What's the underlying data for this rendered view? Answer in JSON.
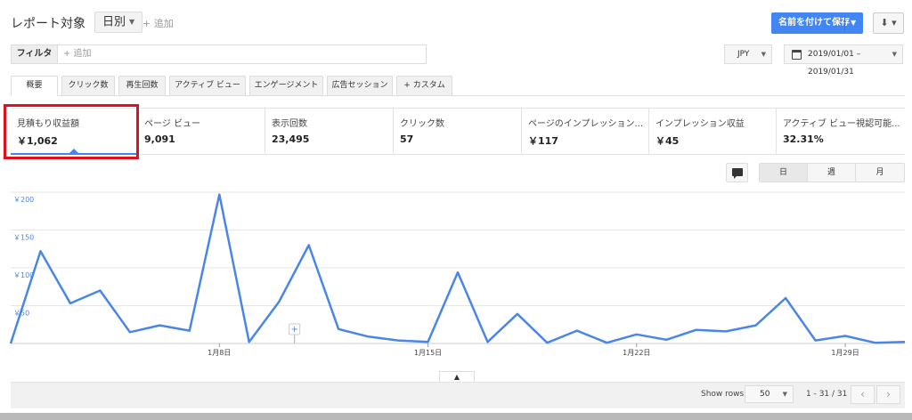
{
  "header": {
    "title": "レポート対象",
    "crumb_separator": "›",
    "dimension_selected": "日別",
    "add_link": "+ 追加",
    "save_button": "名前を付けて保存",
    "download_icon": "download-icon"
  },
  "filter": {
    "label": "フィルタ",
    "placeholder": "+ 追加",
    "currency": "JPY",
    "date_range": "2019/01/01 – 2019/01/31"
  },
  "tabs": [
    {
      "label": "概要",
      "active": true
    },
    {
      "label": "クリック数",
      "active": false
    },
    {
      "label": "再生回数",
      "active": false
    },
    {
      "label": "アクティブ ビュー",
      "active": false
    },
    {
      "label": "エンゲージメント",
      "active": false
    },
    {
      "label": "広告セッション",
      "active": false
    },
    {
      "label": "+ カスタム",
      "active": false
    }
  ],
  "metrics": [
    {
      "label": "見積もり収益額",
      "value": "￥1,062",
      "selected": true
    },
    {
      "label": "ページ ビュー",
      "value": "9,091"
    },
    {
      "label": "表示回数",
      "value": "23,495"
    },
    {
      "label": "クリック数",
      "value": "57"
    },
    {
      "label": "ページのインプレッション...",
      "value": "￥117"
    },
    {
      "label": "インプレッション収益",
      "value": "￥45"
    },
    {
      "label": "アクティブ ビュー視認可能...",
      "value": "32.31%"
    }
  ],
  "granularity": {
    "options": [
      "日",
      "週",
      "月"
    ],
    "selected": "日"
  },
  "chart_data": {
    "type": "line",
    "series": [
      {
        "values": [
          0,
          122,
          53,
          70,
          15,
          24,
          17,
          197,
          2,
          55,
          130,
          19,
          9,
          4,
          2,
          94,
          2,
          39,
          1,
          17,
          1,
          12,
          5,
          18,
          16,
          24,
          60,
          4,
          10,
          1,
          2
        ]
      }
    ],
    "y_ticks": [
      "￥200",
      "￥150",
      "￥100",
      "￥50"
    ],
    "ylim": [
      0,
      200
    ],
    "x_tick_labels": [
      "1月8日",
      "1月15日",
      "1月22日",
      "1月29日"
    ],
    "x_tick_days": [
      8,
      15,
      22,
      29
    ],
    "days": 31,
    "color": "#4a86e8",
    "grid": true
  },
  "footer": {
    "show_rows_label": "Show rows",
    "rows_value": "50",
    "range": "1 - 31 / 31",
    "prev": "‹",
    "next": "›",
    "collapse": "▲"
  }
}
